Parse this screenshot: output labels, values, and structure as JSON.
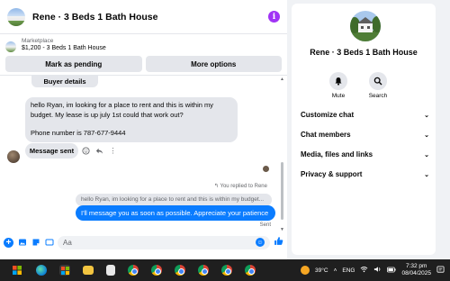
{
  "chat": {
    "title": "Rene · 3 Beds 1 Bath House",
    "info_icon": "i",
    "marketplace_label": "Marketplace",
    "listing": "$1,200 - 3 Beds 1 Bath House",
    "btn_pending": "Mark as pending",
    "btn_more": "More options"
  },
  "messages": {
    "buyer_details": "Buyer details",
    "incoming_line1": "hello Ryan, im looking for a place to rent and this is within my budget. My lease is up july 1st could that work out?",
    "incoming_line2": "Phone number is 787-677-9444",
    "sent_bubble": "Message sent",
    "replied_label": "You replied to Rene",
    "quoted": "hello Ryan, im looking for a place to rent and this is within my budget...",
    "outgoing": "I'll message you as soon as possible. Appreciate your patience",
    "status": "Sent"
  },
  "composer": {
    "placeholder": "Aa"
  },
  "info_panel": {
    "name": "Rene · 3 Beds 1 Bath House",
    "mute_label": "Mute",
    "search_label": "Search",
    "sections": [
      "Customize chat",
      "Chat members",
      "Media, files and links",
      "Privacy & support"
    ]
  },
  "taskbar": {
    "temperature": "39°C",
    "language": "ENG",
    "time": "7:32 pm",
    "date": "08/04/2025"
  },
  "colors": {
    "accent": "#0a7cff",
    "info": "#a033f5",
    "bubble_gray": "#e4e6eb"
  }
}
